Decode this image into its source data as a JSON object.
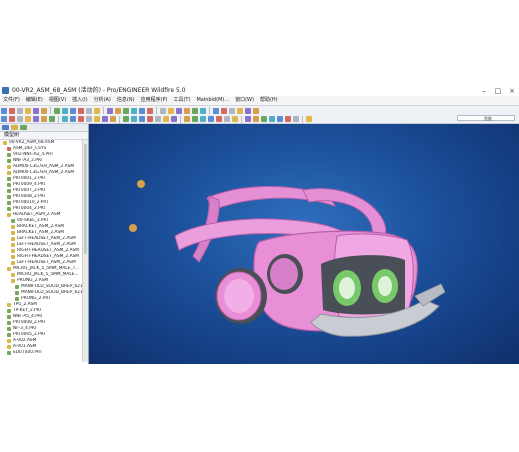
{
  "window": {
    "title": "00-VR2_ASM_68_ASM (活动的) - Pro/ENGINEER Wildfire 5.0",
    "buttons": {
      "minimize": "–",
      "maximize": "□",
      "close": "×"
    }
  },
  "menu": {
    "items": [
      "文件(F)",
      "编辑(E)",
      "视图(V)",
      "插入(I)",
      "分析(A)",
      "信息(N)",
      "应用程序(P)",
      "工具(T)",
      "Mainbid(M)...",
      "窗口(W)",
      "帮助(H)"
    ]
  },
  "search": {
    "label": "智能"
  },
  "panel": {
    "title": "模型树"
  },
  "tree": [
    {
      "label": "00-VR2_ASM_68.ASM",
      "indent": 0,
      "icon": "assembly-icon"
    },
    {
      "label": "ASM_DEF_CSYS",
      "indent": 1,
      "icon": "csys-icon"
    },
    {
      "label": "VR2-NNF-A2_4.PRT",
      "indent": 1,
      "icon": "part-icon"
    },
    {
      "label": "NNF-A3_2.PRT",
      "indent": 1,
      "icon": "part-icon"
    },
    {
      "label": "ADMIXFC3G7E9_ASM_2.ASM",
      "indent": 1,
      "icon": "assembly-icon"
    },
    {
      "label": "ADMIXFC3G7E9_ASM_2.ASM",
      "indent": 1,
      "icon": "assembly-icon"
    },
    {
      "label": "PRT0001_2.PRT",
      "indent": 1,
      "icon": "part-icon"
    },
    {
      "label": "PRT0009_4.PRT",
      "indent": 1,
      "icon": "part-icon"
    },
    {
      "label": "PRT0007_2.PRT",
      "indent": 1,
      "icon": "part-icon"
    },
    {
      "label": "PRT0008_2.PRT",
      "indent": 1,
      "icon": "part-icon"
    },
    {
      "label": "PRT00010_2.PRT",
      "indent": 1,
      "icon": "part-icon"
    },
    {
      "label": "PRT0004_2.PRT",
      "indent": 1,
      "icon": "part-icon"
    },
    {
      "label": "HEADSET_ASM_2.ASM",
      "indent": 1,
      "icon": "assembly-icon"
    },
    {
      "label": "00-SKEL_3.PRT",
      "indent": 2,
      "icon": "part-icon"
    },
    {
      "label": "BRACKET_ASM_2.ASM",
      "indent": 2,
      "icon": "assembly-icon"
    },
    {
      "label": "BRACKET_ASM_2.ASM",
      "indent": 2,
      "icon": "assembly-icon"
    },
    {
      "label": "LEFT-HEADSET_ASM_2.ASM",
      "indent": 2,
      "icon": "assembly-icon"
    },
    {
      "label": "LEFT-HEADSET_ASM_2.ASM",
      "indent": 2,
      "icon": "assembly-icon"
    },
    {
      "label": "RIGHT-HEADSET_ASM_2.ASM",
      "indent": 2,
      "icon": "assembly-icon"
    },
    {
      "label": "RIGHT-HEADSET_ASM_2.ASM",
      "indent": 2,
      "icon": "assembly-icon"
    },
    {
      "label": "LEFT-HEADSET_ASM_2.ASM",
      "indent": 2,
      "icon": "assembly-icon"
    },
    {
      "label": "MICRO_JACK_5_5MM_MALE_T...",
      "indent": 1,
      "icon": "assembly-icon"
    },
    {
      "label": "MICRO_JACK_5_5MM_MALE...",
      "indent": 2,
      "icon": "assembly-icon"
    },
    {
      "label": "PRONG_2.ASM",
      "indent": 2,
      "icon": "assembly-icon"
    },
    {
      "label": "MANIFOLD_SOLID_BREP_621...",
      "indent": 3,
      "icon": "part-icon"
    },
    {
      "label": "MANIFOLD_SOLID_BREP_621...",
      "indent": 3,
      "icon": "part-icon"
    },
    {
      "label": "PRONG_2.PRT",
      "indent": 3,
      "icon": "part-icon"
    },
    {
      "label": "TPU_2.ASM",
      "indent": 1,
      "icon": "assembly-icon"
    },
    {
      "label": "TP-KEY_2.PRT",
      "indent": 1,
      "icon": "part-icon"
    },
    {
      "label": "NNF-A5_4.PRT",
      "indent": 1,
      "icon": "part-icon"
    },
    {
      "label": "PRT0008_2.PRT",
      "indent": 1,
      "icon": "part-icon"
    },
    {
      "label": "NF-3_4.PRT",
      "indent": 1,
      "icon": "part-icon"
    },
    {
      "label": "PRT0005_2.PRT",
      "indent": 1,
      "icon": "part-icon"
    },
    {
      "label": "A-002.ASM",
      "indent": 1,
      "icon": "assembly-icon"
    },
    {
      "label": "A-001.ASM",
      "indent": 1,
      "icon": "assembly-icon"
    },
    {
      "label": "EDUT400.PRT",
      "indent": 1,
      "icon": "part-icon"
    }
  ],
  "colors": {
    "viewport_center": "#2f6fbe",
    "viewport_edge": "#0f2f6c",
    "model_pink": "#e58fd6",
    "model_pink_dark": "#b95fa8",
    "model_gray": "#4a4f57",
    "lens_green": "#77c96a",
    "tray_silver": "#c9ccd3"
  }
}
